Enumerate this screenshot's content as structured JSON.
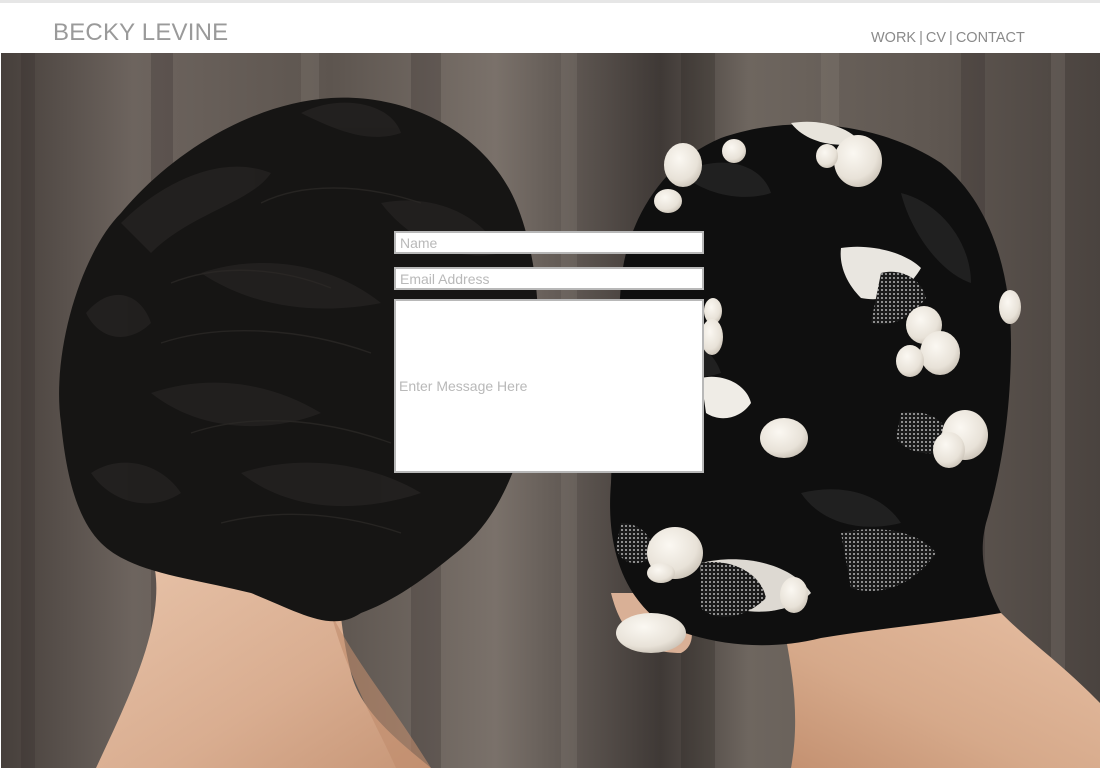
{
  "header": {
    "site_title": "BECKY LEVINE",
    "nav": {
      "work": "WORK",
      "cv": "CV",
      "contact": "CONTACT",
      "separator": "|"
    }
  },
  "contact_form": {
    "name_placeholder": "Name",
    "email_placeholder": "Email Address",
    "message_placeholder": "Enter Message Here"
  },
  "colors": {
    "title": "#9a9a9a",
    "nav": "#8a8a8a",
    "field_border": "#b8b8b8",
    "placeholder": "#b9b9b9"
  }
}
